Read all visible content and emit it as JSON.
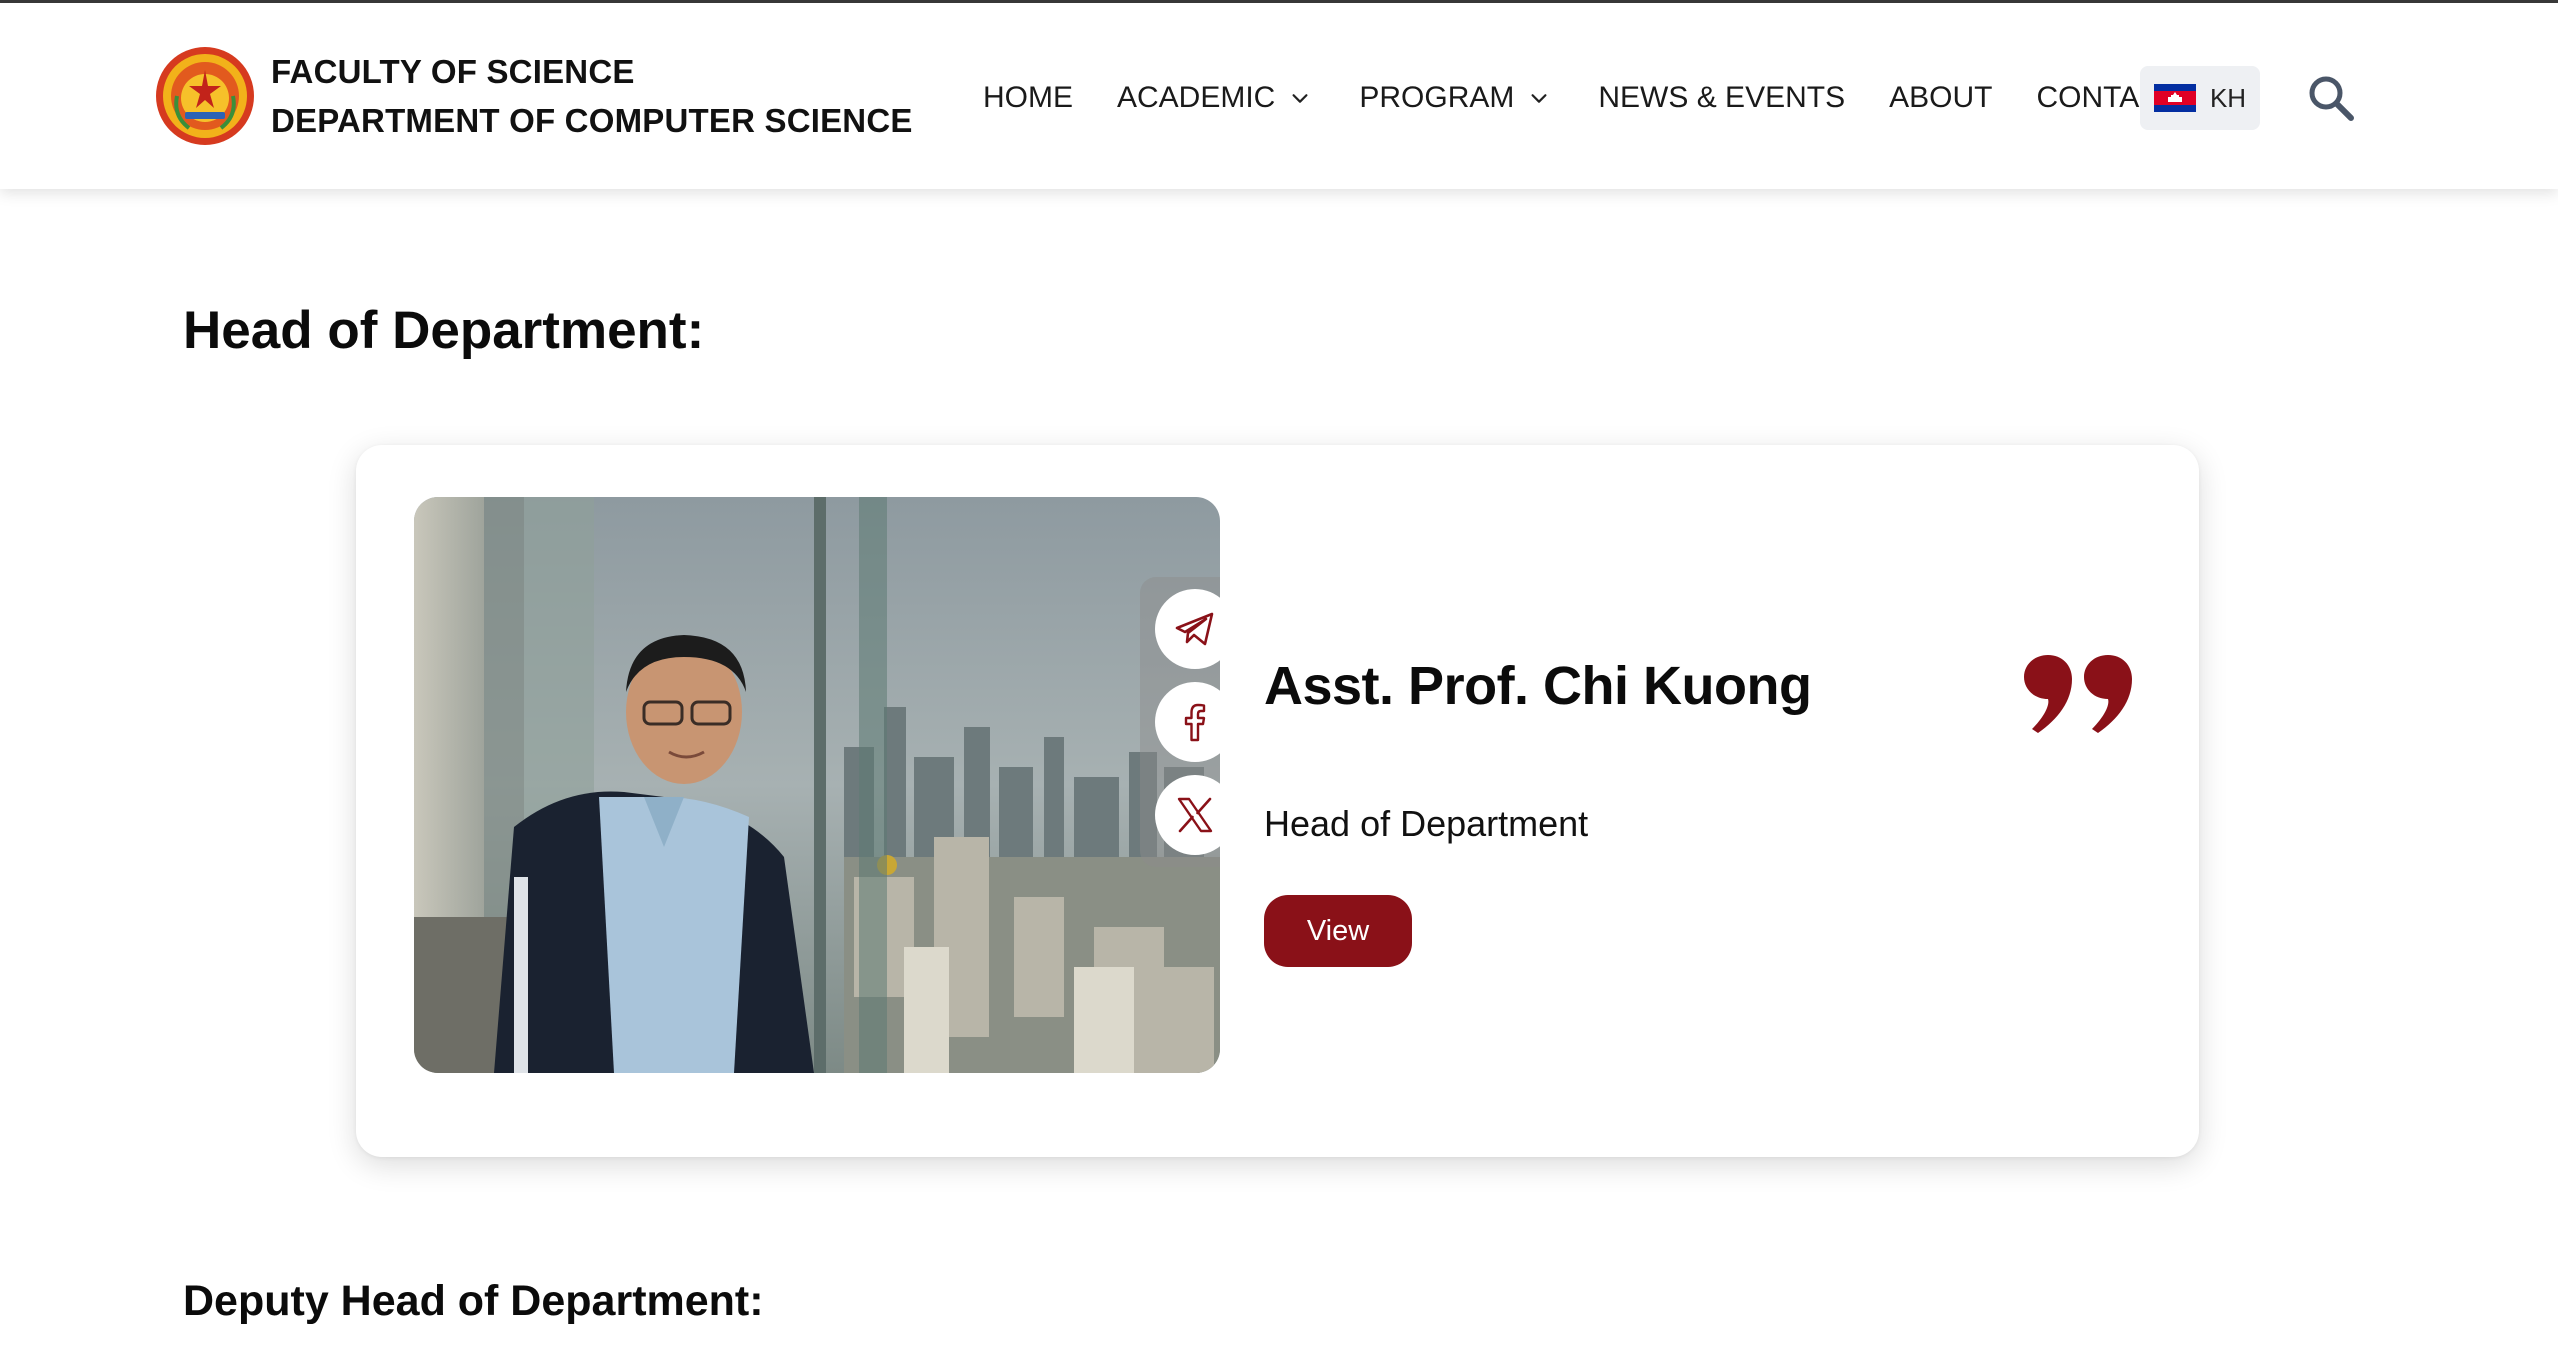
{
  "header": {
    "title_line1": "FACULTY OF SCIENCE",
    "title_line2": "DEPARTMENT OF COMPUTER SCIENCE",
    "logo_icon": "university-seal-icon",
    "nav": {
      "home": "HOME",
      "academic": "ACADEMIC",
      "program": "PROGRAM",
      "news": "NEWS & EVENTS",
      "about": "ABOUT",
      "contact": "CONTACT"
    },
    "language": {
      "label": "KH",
      "flag_icon": "cambodia-flag-icon"
    },
    "search_icon": "search-icon"
  },
  "sections": {
    "head_title": "Head of Department:",
    "deputy_title": "Deputy Head of Department:"
  },
  "profile": {
    "name": "Asst. Prof. Chi Kuong",
    "role": "Head of Department",
    "view_label": "View",
    "social_icons": [
      "telegram-icon",
      "facebook-icon",
      "x-icon"
    ],
    "quote_icon": "quote-icon"
  },
  "colors": {
    "accent": "#8a1118",
    "header_bg": "#ffffff",
    "lang_bg": "#eef0f3",
    "text": "#111111"
  }
}
